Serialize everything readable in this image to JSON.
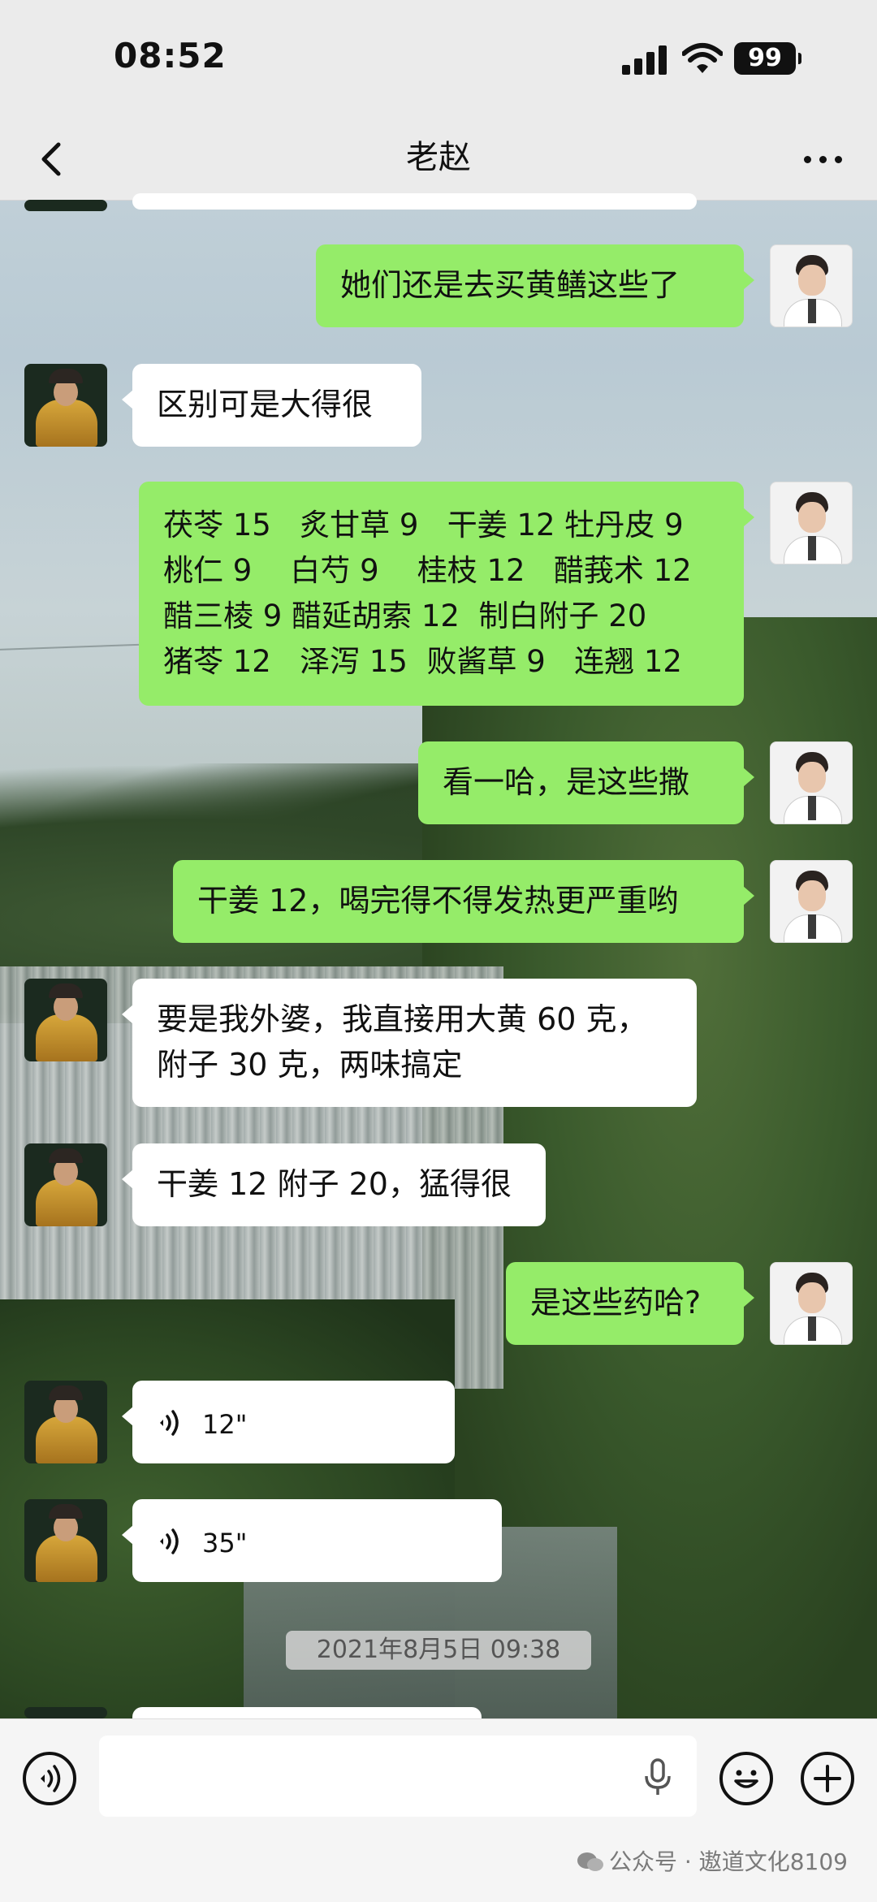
{
  "status_bar": {
    "time": "08:52",
    "battery": "99"
  },
  "header": {
    "title": "老赵"
  },
  "messages": [
    {
      "side": "out",
      "lines": [
        "她们还是去买黄鳝这些了"
      ]
    },
    {
      "side": "in",
      "lines": [
        "区别可是大得很"
      ]
    },
    {
      "side": "out",
      "lines": [
        "茯苓 15   炙甘草 9   干姜 12 牡丹皮 9",
        "桃仁 9    白芍 9    桂枝 12   醋莪术 12",
        "醋三棱 9 醋延胡索 12  制白附子 20",
        "猪苓 12   泽泻 15  败酱草 9   连翘 12"
      ]
    },
    {
      "side": "out",
      "lines": [
        "看一哈，是这些撒"
      ]
    },
    {
      "side": "out",
      "lines": [
        "干姜 12，喝完得不得发热更严重哟"
      ]
    },
    {
      "side": "in",
      "lines": [
        "要是我外婆，我直接用大黄 60 克，",
        "附子 30 克，两味搞定"
      ]
    },
    {
      "side": "in",
      "lines": [
        "干姜 12 附子 20，猛得很"
      ]
    },
    {
      "side": "out",
      "lines": [
        "是这些药哈?"
      ]
    },
    {
      "side": "in",
      "type": "voice",
      "duration": "12\""
    },
    {
      "side": "in",
      "type": "voice",
      "duration": "35\""
    }
  ],
  "timestamp": "2021年8月5日 09:38",
  "input_bar": {
    "placeholder": ""
  },
  "watermark": "公众号 · 遨道文化8109",
  "icons": [
    "back-icon",
    "more-icon",
    "voice-mode-icon",
    "microphone-icon",
    "emoji-icon",
    "plus-icon",
    "voice-message-icon",
    "wechat-icon"
  ]
}
